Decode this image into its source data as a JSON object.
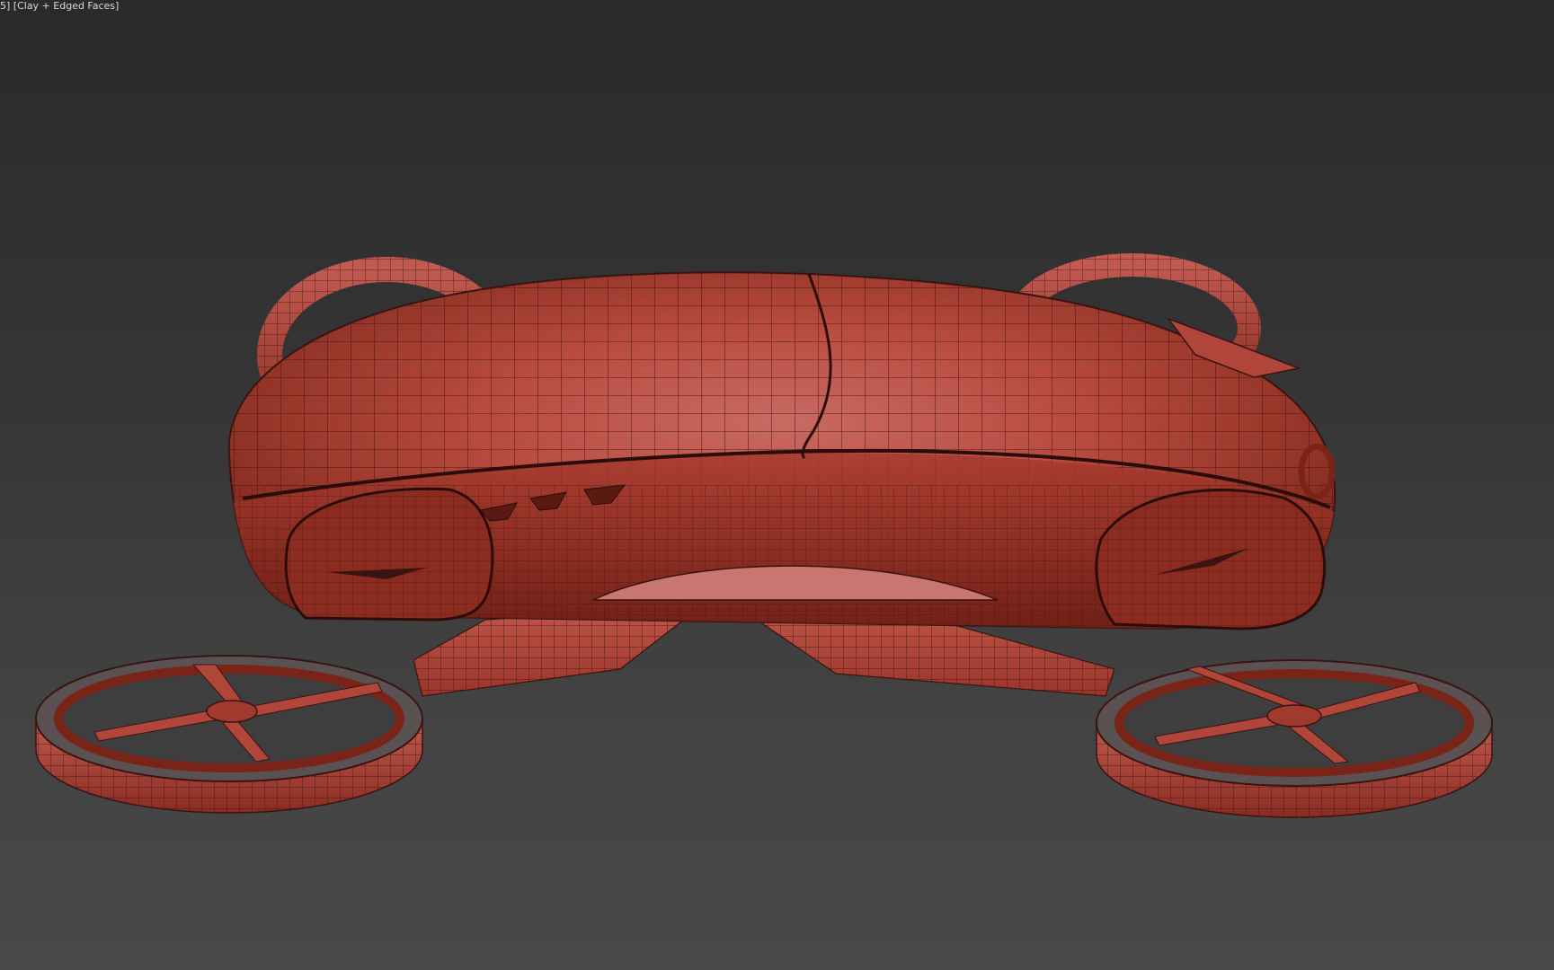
{
  "viewport": {
    "label": "5] [Clay + Edged Faces]",
    "shading_mode": "Clay + Edged Faces"
  },
  "scene": {
    "subject": "flying-car-model",
    "model_color": "#b8453a",
    "wire_color": "#3a1410",
    "background_top": "#2a2a2a",
    "background_bottom": "#484848"
  }
}
